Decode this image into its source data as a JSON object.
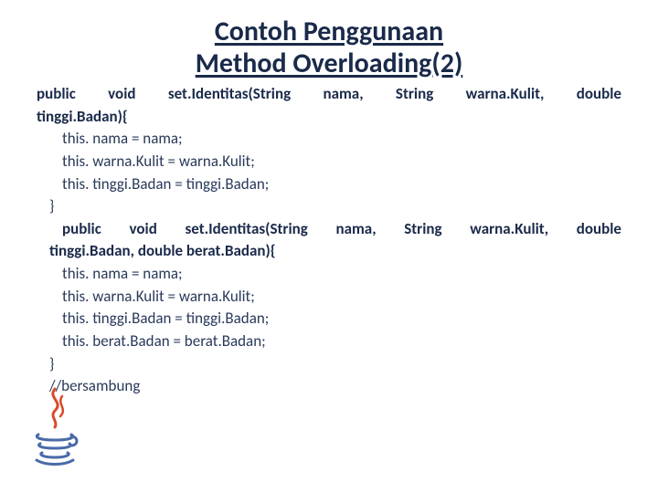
{
  "title_line1": "Contoh Penggunaan",
  "title_line2": "Method Overloading(2)",
  "code": {
    "sig1_a": "public void set.Identitas(String nama, String warna.Kulit, double",
    "sig1_b": "tinggi.Badan){",
    "l1": "this. nama = nama;",
    "l2": "this. warna.Kulit = warna.Kulit;",
    "l3": "this. tinggi.Badan = tinggi.Badan;",
    "close1": "}",
    "sig2_a": "public void set.Identitas(String nama, String warna.Kulit, double",
    "sig2_b": "tinggi.Badan, double berat.Badan){",
    "l4": "this. nama = nama;",
    "l5": "this. warna.Kulit = warna.Kulit;",
    "l6": "this. tinggi.Badan = tinggi.Badan;",
    "l7": "this. berat.Badan = berat.Badan;",
    "close2": "}",
    "comment": "//bersambung"
  },
  "logo_name": "java-logo"
}
